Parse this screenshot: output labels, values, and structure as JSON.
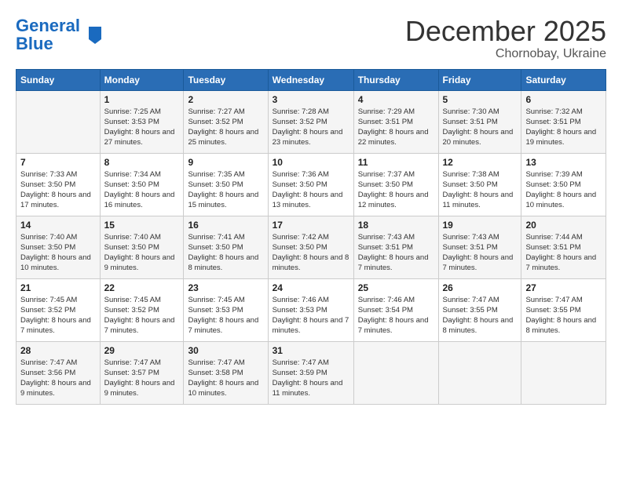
{
  "header": {
    "logo_line1": "General",
    "logo_line2": "Blue",
    "main_title": "December 2025",
    "sub_title": "Chornobay, Ukraine"
  },
  "days_of_week": [
    "Sunday",
    "Monday",
    "Tuesday",
    "Wednesday",
    "Thursday",
    "Friday",
    "Saturday"
  ],
  "weeks": [
    [
      {
        "day": "",
        "info": ""
      },
      {
        "day": "1",
        "info": "Sunrise: 7:25 AM\nSunset: 3:53 PM\nDaylight: 8 hours\nand 27 minutes."
      },
      {
        "day": "2",
        "info": "Sunrise: 7:27 AM\nSunset: 3:52 PM\nDaylight: 8 hours\nand 25 minutes."
      },
      {
        "day": "3",
        "info": "Sunrise: 7:28 AM\nSunset: 3:52 PM\nDaylight: 8 hours\nand 23 minutes."
      },
      {
        "day": "4",
        "info": "Sunrise: 7:29 AM\nSunset: 3:51 PM\nDaylight: 8 hours\nand 22 minutes."
      },
      {
        "day": "5",
        "info": "Sunrise: 7:30 AM\nSunset: 3:51 PM\nDaylight: 8 hours\nand 20 minutes."
      },
      {
        "day": "6",
        "info": "Sunrise: 7:32 AM\nSunset: 3:51 PM\nDaylight: 8 hours\nand 19 minutes."
      }
    ],
    [
      {
        "day": "7",
        "info": "Sunrise: 7:33 AM\nSunset: 3:50 PM\nDaylight: 8 hours\nand 17 minutes."
      },
      {
        "day": "8",
        "info": "Sunrise: 7:34 AM\nSunset: 3:50 PM\nDaylight: 8 hours\nand 16 minutes."
      },
      {
        "day": "9",
        "info": "Sunrise: 7:35 AM\nSunset: 3:50 PM\nDaylight: 8 hours\nand 15 minutes."
      },
      {
        "day": "10",
        "info": "Sunrise: 7:36 AM\nSunset: 3:50 PM\nDaylight: 8 hours\nand 13 minutes."
      },
      {
        "day": "11",
        "info": "Sunrise: 7:37 AM\nSunset: 3:50 PM\nDaylight: 8 hours\nand 12 minutes."
      },
      {
        "day": "12",
        "info": "Sunrise: 7:38 AM\nSunset: 3:50 PM\nDaylight: 8 hours\nand 11 minutes."
      },
      {
        "day": "13",
        "info": "Sunrise: 7:39 AM\nSunset: 3:50 PM\nDaylight: 8 hours\nand 10 minutes."
      }
    ],
    [
      {
        "day": "14",
        "info": "Sunrise: 7:40 AM\nSunset: 3:50 PM\nDaylight: 8 hours\nand 10 minutes."
      },
      {
        "day": "15",
        "info": "Sunrise: 7:40 AM\nSunset: 3:50 PM\nDaylight: 8 hours\nand 9 minutes."
      },
      {
        "day": "16",
        "info": "Sunrise: 7:41 AM\nSunset: 3:50 PM\nDaylight: 8 hours\nand 8 minutes."
      },
      {
        "day": "17",
        "info": "Sunrise: 7:42 AM\nSunset: 3:50 PM\nDaylight: 8 hours\nand 8 minutes."
      },
      {
        "day": "18",
        "info": "Sunrise: 7:43 AM\nSunset: 3:51 PM\nDaylight: 8 hours\nand 7 minutes."
      },
      {
        "day": "19",
        "info": "Sunrise: 7:43 AM\nSunset: 3:51 PM\nDaylight: 8 hours\nand 7 minutes."
      },
      {
        "day": "20",
        "info": "Sunrise: 7:44 AM\nSunset: 3:51 PM\nDaylight: 8 hours\nand 7 minutes."
      }
    ],
    [
      {
        "day": "21",
        "info": "Sunrise: 7:45 AM\nSunset: 3:52 PM\nDaylight: 8 hours\nand 7 minutes."
      },
      {
        "day": "22",
        "info": "Sunrise: 7:45 AM\nSunset: 3:52 PM\nDaylight: 8 hours\nand 7 minutes."
      },
      {
        "day": "23",
        "info": "Sunrise: 7:45 AM\nSunset: 3:53 PM\nDaylight: 8 hours\nand 7 minutes."
      },
      {
        "day": "24",
        "info": "Sunrise: 7:46 AM\nSunset: 3:53 PM\nDaylight: 8 hours\nand 7 minutes."
      },
      {
        "day": "25",
        "info": "Sunrise: 7:46 AM\nSunset: 3:54 PM\nDaylight: 8 hours\nand 7 minutes."
      },
      {
        "day": "26",
        "info": "Sunrise: 7:47 AM\nSunset: 3:55 PM\nDaylight: 8 hours\nand 8 minutes."
      },
      {
        "day": "27",
        "info": "Sunrise: 7:47 AM\nSunset: 3:55 PM\nDaylight: 8 hours\nand 8 minutes."
      }
    ],
    [
      {
        "day": "28",
        "info": "Sunrise: 7:47 AM\nSunset: 3:56 PM\nDaylight: 8 hours\nand 9 minutes."
      },
      {
        "day": "29",
        "info": "Sunrise: 7:47 AM\nSunset: 3:57 PM\nDaylight: 8 hours\nand 9 minutes."
      },
      {
        "day": "30",
        "info": "Sunrise: 7:47 AM\nSunset: 3:58 PM\nDaylight: 8 hours\nand 10 minutes."
      },
      {
        "day": "31",
        "info": "Sunrise: 7:47 AM\nSunset: 3:59 PM\nDaylight: 8 hours\nand 11 minutes."
      },
      {
        "day": "",
        "info": ""
      },
      {
        "day": "",
        "info": ""
      },
      {
        "day": "",
        "info": ""
      }
    ]
  ]
}
